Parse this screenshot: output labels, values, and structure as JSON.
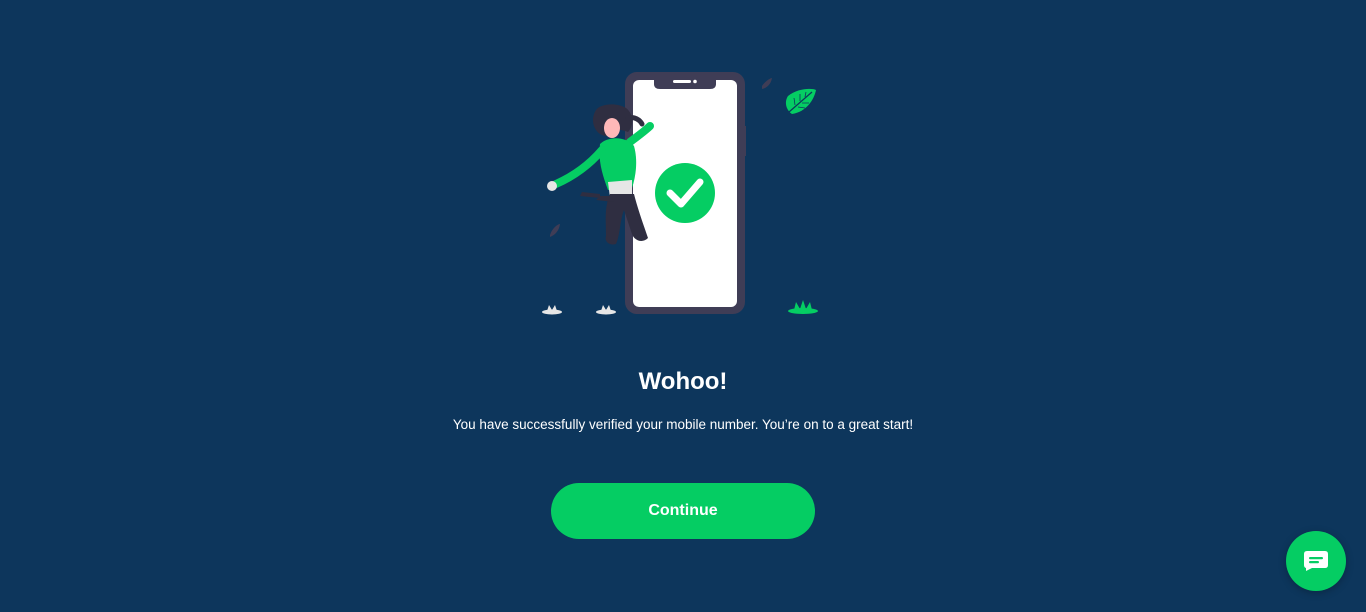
{
  "colors": {
    "background": "#0d365c",
    "accent": "#05cd63",
    "phone_frame": "#3f3d56",
    "text": "#ffffff"
  },
  "hero": {
    "illustration": "woman-jumping-beside-phone-with-checkmark",
    "icon": "check-circle-icon"
  },
  "message": {
    "title": "Wohoo!",
    "subtitle": "You have successfully verified your mobile number. You’re on to a great start!"
  },
  "actions": {
    "continue_label": "Continue"
  },
  "chat": {
    "icon": "chat-bubble-icon"
  }
}
